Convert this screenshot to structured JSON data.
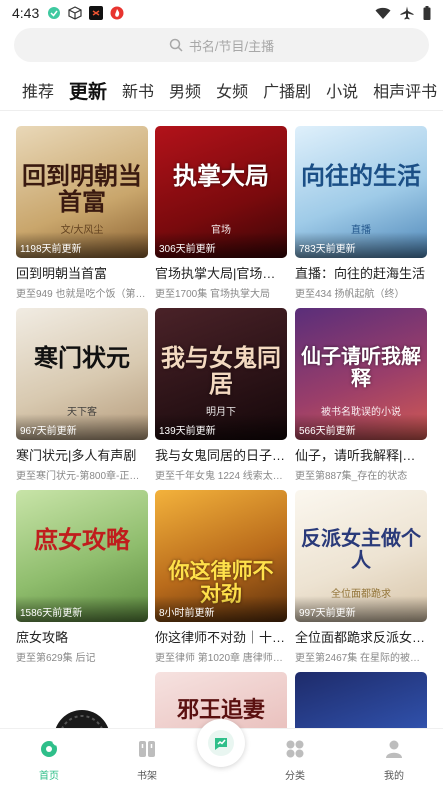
{
  "status_bar": {
    "time": "4:43",
    "left_icons": [
      "app-notification-icon",
      "cube-icon",
      "tiktok-icon",
      "flame-icon"
    ],
    "right_icons": [
      "wifi-icon",
      "airplane-mode-icon",
      "battery-icon"
    ]
  },
  "search": {
    "placeholder": "书名/节目/主播"
  },
  "tabs": [
    "推荐",
    "更新",
    "新书",
    "男频",
    "女频",
    "广播剧",
    "小说",
    "相声评书"
  ],
  "active_tab": "更新",
  "books": [
    {
      "title": "回到明朝当首富",
      "subtitle": "更至949 也就是吃个饭（第…",
      "badge": "1198天前更新",
      "cover_text": "回到明朝当首富",
      "cover_sub": "文/大风尘"
    },
    {
      "title": "官场执掌大局|官场局…",
      "subtitle": "更至1700集 官场执掌大局",
      "badge": "306天前更新",
      "cover_text": "执掌大局",
      "cover_sub": "官场"
    },
    {
      "title": "直播：向往的赶海生活",
      "subtitle": "更至434 扬帆起航（终）",
      "badge": "783天前更新",
      "cover_text": "向往的生活",
      "cover_sub": "直播"
    },
    {
      "title": "寒门状元|多人有声剧",
      "subtitle": "更至寒门状元-第800章-正三…",
      "badge": "967天前更新",
      "cover_text": "寒门状元",
      "cover_sub": "天下客"
    },
    {
      "title": "我与女鬼同居的日子|…",
      "subtitle": "更至千年女鬼 1224 线索太…",
      "badge": "139天前更新",
      "cover_text": "我与女鬼同居",
      "cover_sub": "明月下"
    },
    {
      "title": "仙子，请听我解释|多…",
      "subtitle": "更至第887集_存在的状态",
      "badge": "566天前更新",
      "cover_text": "仙子请听我解释",
      "cover_sub": "被书名耽误的小说"
    },
    {
      "title": "庶女攻略",
      "subtitle": "更至第629集 后记",
      "badge": "1586天前更新",
      "cover_text": "庶女攻略",
      "cover_sub": ""
    },
    {
      "title": "你这律师不对劲｜十…",
      "subtitle": "更至律师 第1020章 唐律师，…",
      "badge": "8小时前更新",
      "cover_text": "你这律师不对劲",
      "cover_sub": ""
    },
    {
      "title": "全位面都跪求反派女…",
      "subtitle": "更至第2467集 在星际的被迫…",
      "badge": "997天前更新",
      "cover_text": "反派女主做个人",
      "cover_sub": "全位面都跪求"
    },
    {
      "title": "",
      "subtitle": "",
      "badge": "",
      "cover_text": "",
      "cover_sub": ""
    },
    {
      "title": "",
      "subtitle": "",
      "badge": "",
      "cover_text": "邪王追妻",
      "cover_sub": ""
    },
    {
      "title": "",
      "subtitle": "",
      "badge": "",
      "cover_text": "",
      "cover_sub": ""
    }
  ],
  "bottom_nav": [
    {
      "label": "首页",
      "icon": "home-icon",
      "active": true
    },
    {
      "label": "书架",
      "icon": "bookshelf-icon",
      "active": false
    },
    {
      "label": "",
      "icon": "play-center-icon",
      "active": false
    },
    {
      "label": "分类",
      "icon": "category-icon",
      "active": false
    },
    {
      "label": "我的",
      "icon": "profile-icon",
      "active": false
    }
  ],
  "colors": {
    "accent": "#2fbf8a",
    "search_bg": "#f2f2f2",
    "text_primary": "#222222",
    "text_secondary": "#888888"
  }
}
